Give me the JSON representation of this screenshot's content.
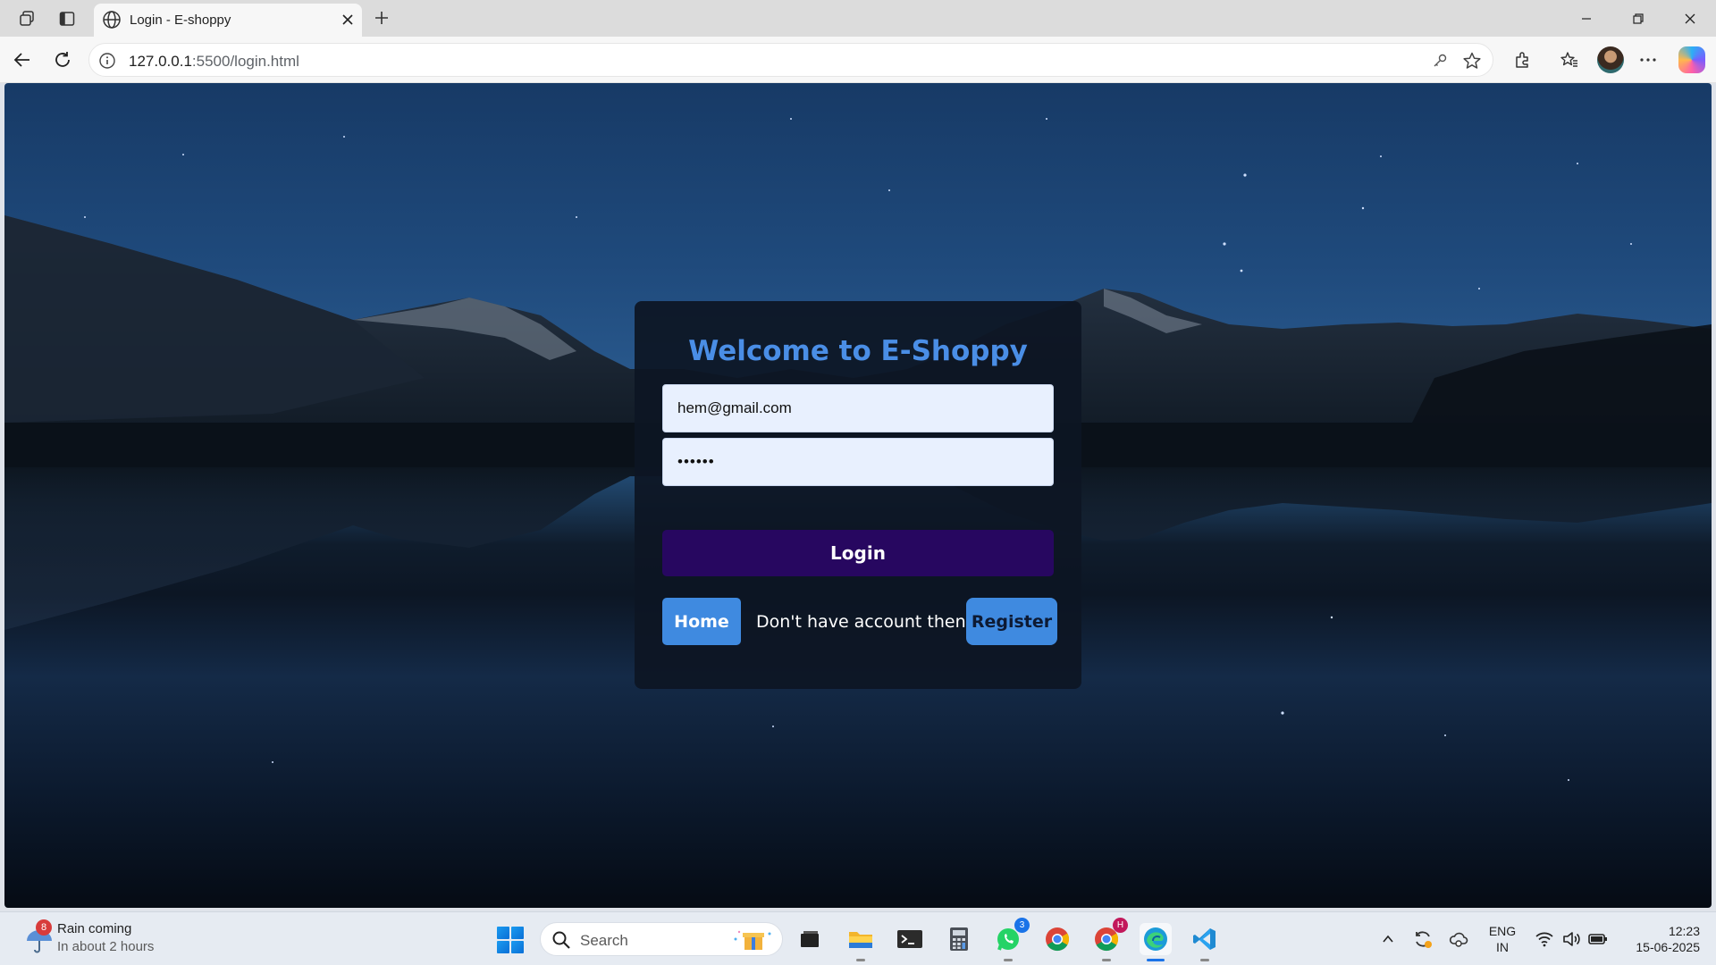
{
  "browser": {
    "tab": {
      "title": "Login - E-shoppy"
    },
    "address": {
      "host": "127.0.0.1",
      "path": ":5500/login.html"
    }
  },
  "page": {
    "heading": "Welcome to E-Shoppy",
    "email_value": "hem@gmail.com",
    "password_value": "••••••",
    "login_label": "Login",
    "home_label": "Home",
    "no_account_text": "Don't have account then ?",
    "register_label": "Register",
    "colors": {
      "heading": "#4a8ee6",
      "login_button": "#270760",
      "secondary_button": "#3f8ae0"
    }
  },
  "taskbar": {
    "weather": {
      "badge": "8",
      "title": "Rain coming",
      "subtitle": "In about 2 hours"
    },
    "search_placeholder": "Search",
    "apps": [
      {
        "name": "task-view-icon"
      },
      {
        "name": "file-explorer-icon"
      },
      {
        "name": "terminal-icon"
      },
      {
        "name": "calculator-icon"
      },
      {
        "name": "whatsapp-icon",
        "badge": "3"
      },
      {
        "name": "chrome-icon"
      },
      {
        "name": "chrome-profile-icon",
        "badge": "H"
      },
      {
        "name": "edge-icon"
      },
      {
        "name": "vscode-icon"
      }
    ],
    "language": {
      "line1": "ENG",
      "line2": "IN"
    },
    "clock": {
      "time": "12:23",
      "date": "15-06-2025"
    }
  }
}
